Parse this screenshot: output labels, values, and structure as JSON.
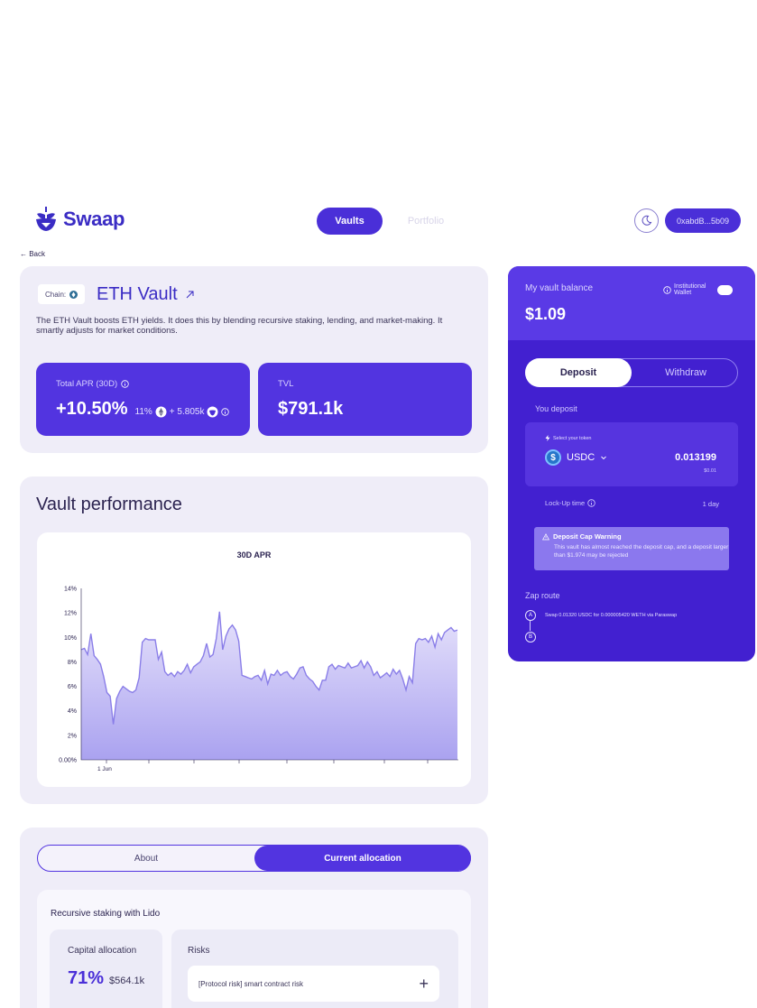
{
  "header": {
    "logo_text": "Swaap",
    "nav": {
      "vaults": "Vaults",
      "portfolio": "Portfolio"
    },
    "wallet_address": "0xabdB...5b09",
    "theme_icon": "moon-icon"
  },
  "back_label": "← Back",
  "vault": {
    "chain_label": "Chain:",
    "title": "ETH Vault",
    "description": "The ETH Vault boosts ETH yields. It does this by blending recursive staking, lending, and market-making. It smartly adjusts for market conditions.",
    "apr_label": "Total APR (30D)",
    "apr_value": "+10.50%",
    "apr_detail_1": "11%",
    "apr_detail_2": "+ 5.805k",
    "tvl_label": "TVL",
    "tvl_value": "$791.1k"
  },
  "performance": {
    "title": "Vault performance",
    "chart_title": "30D APR"
  },
  "chart_data": {
    "type": "area",
    "title": "30D APR",
    "xlabel": "",
    "ylabel": "",
    "ylim": [
      0,
      14
    ],
    "y_ticks": [
      "0.00%",
      "2%",
      "4%",
      "6%",
      "8%",
      "10%",
      "12%",
      "14%"
    ],
    "x_ticks": [
      "1 Jun"
    ],
    "grid": false,
    "series": [
      {
        "values": [
          9.0,
          9.1,
          8.6,
          10.3,
          8.5,
          8.2,
          7.8,
          6.8,
          5.5,
          5.2,
          2.9,
          5.0,
          5.6,
          6.0,
          5.8,
          5.6,
          5.5,
          5.7,
          6.7,
          9.6,
          9.9,
          9.8,
          9.8,
          9.8,
          8.2,
          8.8,
          7.2,
          6.9,
          7.1,
          6.8,
          7.2,
          7.0,
          7.3,
          7.8,
          7.1,
          7.6,
          7.8,
          8.0,
          8.5,
          9.5,
          8.4,
          8.6,
          9.9,
          12.1,
          9.0,
          10.1,
          10.7,
          11.0,
          10.6,
          9.7,
          6.9,
          6.8,
          6.7,
          6.6,
          6.8,
          6.9,
          6.5,
          7.3,
          6.2,
          7.0,
          6.9,
          7.3,
          6.9,
          7.1,
          7.2,
          6.8,
          6.6,
          7.0,
          7.5,
          7.6,
          6.9,
          6.6,
          6.4,
          6.0,
          5.7,
          6.5,
          6.5,
          7.6,
          7.8,
          7.4,
          7.7,
          7.6,
          7.5,
          7.9,
          7.5,
          7.6,
          7.7,
          8.1,
          7.5,
          8.0,
          7.6,
          6.9,
          7.2,
          6.7,
          6.9,
          7.1,
          6.8,
          7.4,
          7.0,
          7.3,
          6.6,
          5.7,
          6.8,
          6.3,
          9.5,
          9.9,
          9.8,
          9.9,
          9.6,
          10.1,
          9.2,
          10.3,
          9.8,
          10.4,
          10.6,
          10.8,
          10.5,
          10.6
        ]
      }
    ]
  },
  "allocation": {
    "tab_about": "About",
    "tab_current": "Current allocation",
    "strategy_name": "Recursive staking with Lido",
    "capital_label": "Capital allocation",
    "capital_pct": "71%",
    "capital_amt": "$564.1k",
    "risks_label": "Risks",
    "risk_item": "[Protocol risk] smart contract risk"
  },
  "panel": {
    "balance_label": "My vault balance",
    "balance_value": "$1.09",
    "institutional_line1": "Institutional",
    "institutional_line2": "Wallet",
    "tab_deposit": "Deposit",
    "tab_withdraw": "Withdraw",
    "you_deposit": "You deposit",
    "select_token": "Select your token",
    "token": "USDC",
    "token_amount": "0.013199",
    "token_usd": "$0.01",
    "lockup_label": "Lock-Up time",
    "lockup_value": "1 day",
    "warning_title": "Deposit Cap Warning",
    "warning_text": "This vault has almost reached the deposit cap, and a deposit larger than $1.974 may be rejected",
    "zap_label": "Zap route",
    "zap_step_a": "A",
    "zap_step_b": "B",
    "zap_text": "Swap 0.01320 USDC for 0.000005420 WETH via Paraswap"
  }
}
